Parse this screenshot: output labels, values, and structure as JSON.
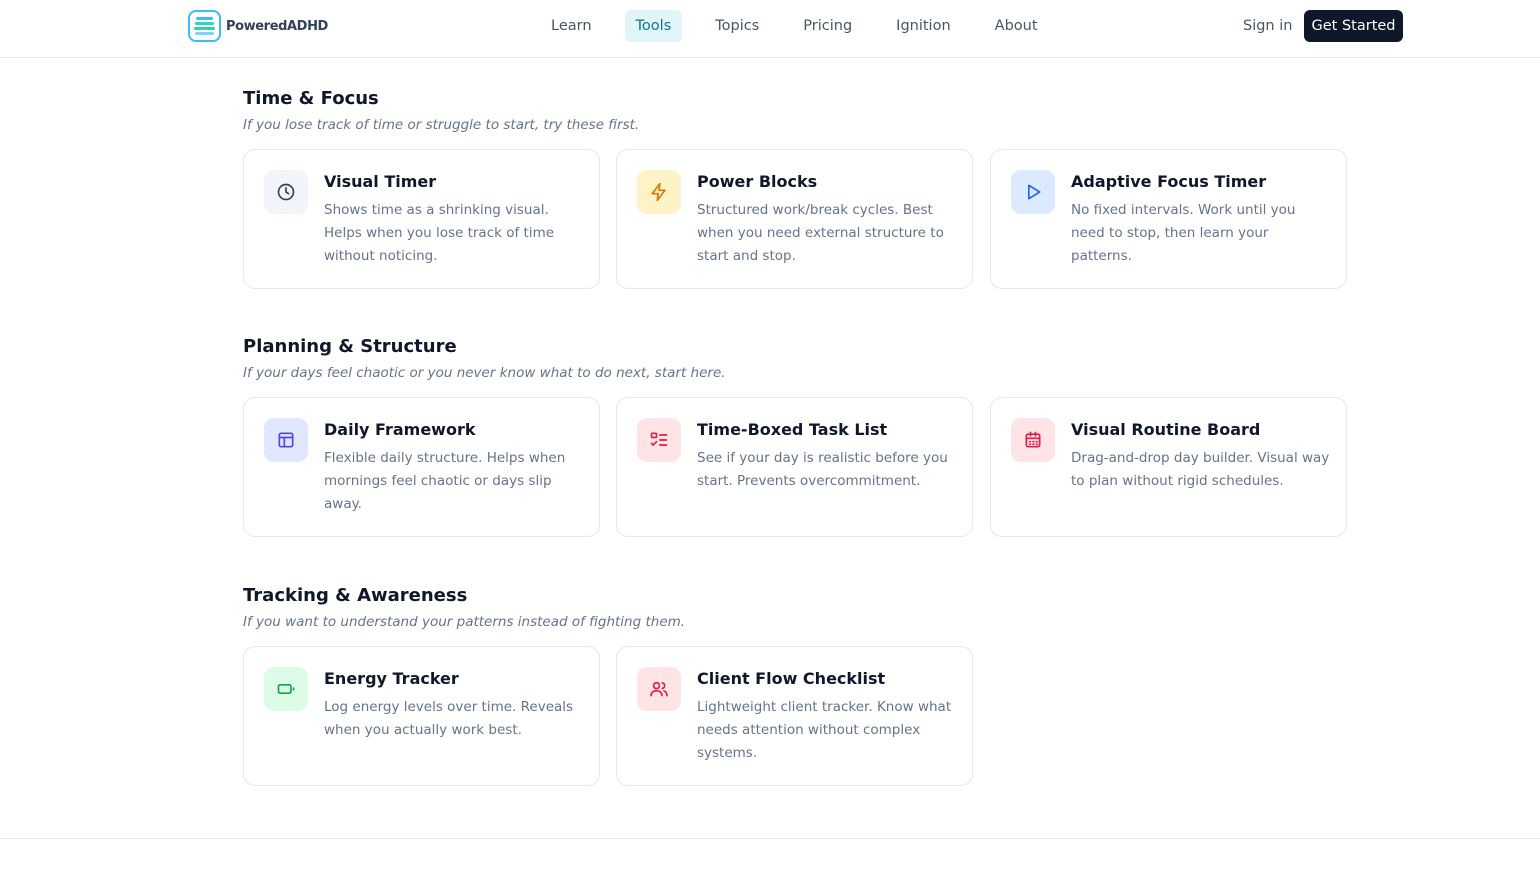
{
  "brand": {
    "name": "PoweredADHD"
  },
  "nav": [
    {
      "label": "Learn"
    },
    {
      "label": "Tools",
      "active": true
    },
    {
      "label": "Topics"
    },
    {
      "label": "Pricing"
    },
    {
      "label": "Ignition"
    },
    {
      "label": "About"
    }
  ],
  "auth": {
    "signin": "Sign in",
    "cta": "Get Started"
  },
  "sections": [
    {
      "title": "Time & Focus",
      "subtitle": "If you lose track of time or struggle to start, try these first.",
      "tools": [
        {
          "title": "Visual Timer",
          "desc": "Shows time as a shrinking visual. Helps when you lose track of time without noticing.",
          "icon": "clock-icon",
          "bg": "#f1f5f9",
          "fg": "#334155"
        },
        {
          "title": "Power Blocks",
          "desc": "Structured work/break cycles. Best when you need external structure to start and stop.",
          "icon": "lightning-icon",
          "bg": "#fef3c7",
          "fg": "#d97706"
        },
        {
          "title": "Adaptive Focus Timer",
          "desc": "No fixed intervals. Work until you need to stop, then learn your patterns.",
          "icon": "play-icon",
          "bg": "#dbeafe",
          "fg": "#2563eb"
        }
      ]
    },
    {
      "title": "Planning & Structure",
      "subtitle": "If your days feel chaotic or you never know what to do next, start here.",
      "tools": [
        {
          "title": "Daily Framework",
          "desc": "Flexible daily structure. Helps when mornings feel chaotic or days slip away.",
          "icon": "layout-icon",
          "bg": "#e0e7ff",
          "fg": "#4f46e5"
        },
        {
          "title": "Time-Boxed Task List",
          "desc": "See if your day is realistic before you start. Prevents overcommitment.",
          "icon": "checklist-icon",
          "bg": "#ffe4e6",
          "fg": "#e11d48"
        },
        {
          "title": "Visual Routine Board",
          "desc": "Drag-and-drop day builder. Visual way to plan without rigid schedules.",
          "icon": "calendar-icon",
          "bg": "#ffe4e6",
          "fg": "#e11d48"
        }
      ]
    },
    {
      "title": "Tracking & Awareness",
      "subtitle": "If you want to understand your patterns instead of fighting them.",
      "tools": [
        {
          "title": "Energy Tracker",
          "desc": "Log energy levels over time. Reveals when you actually work best.",
          "icon": "battery-icon",
          "bg": "#dcfce7",
          "fg": "#16a34a"
        },
        {
          "title": "Client Flow Checklist",
          "desc": "Lightweight client tracker. Know what needs attention without complex systems.",
          "icon": "users-icon",
          "bg": "#ffe4e6",
          "fg": "#e11d48"
        }
      ]
    }
  ]
}
